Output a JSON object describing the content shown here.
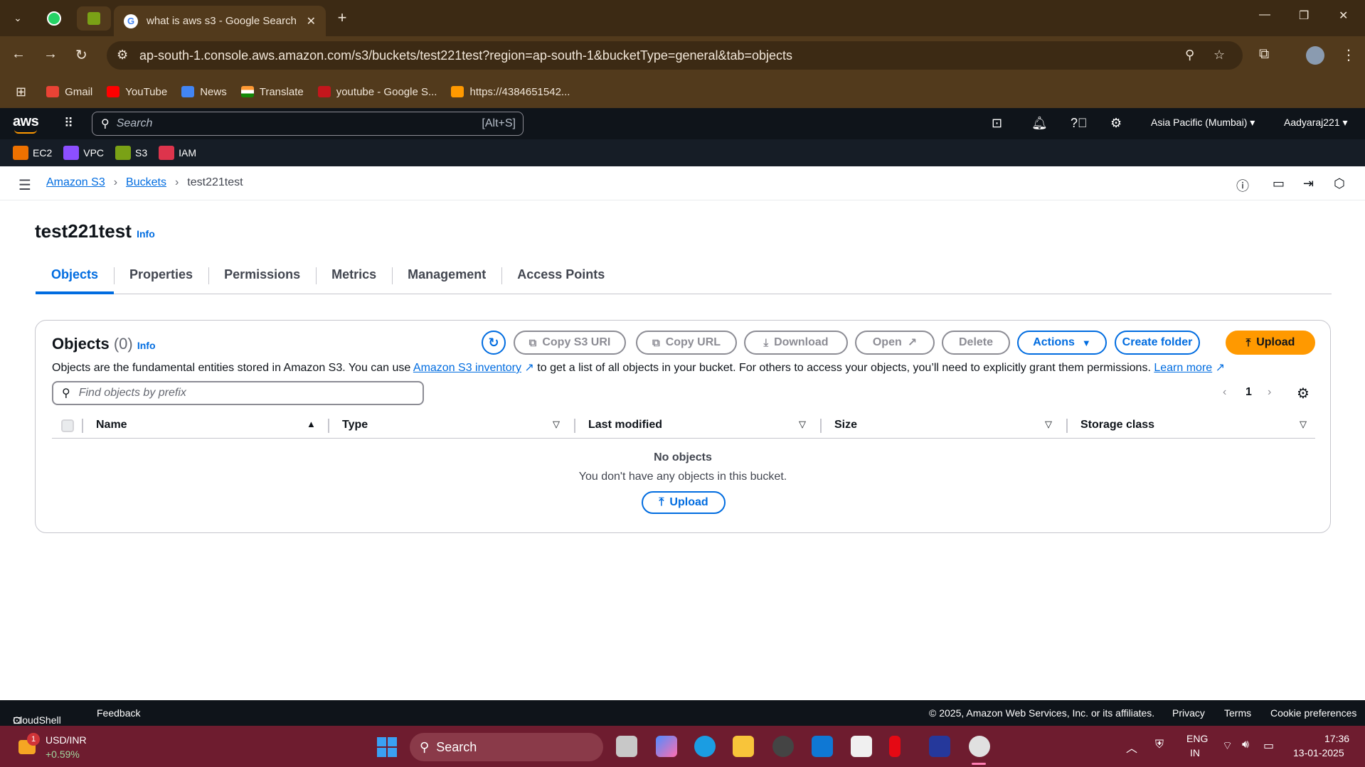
{
  "browser": {
    "active_tab_title": "what is aws s3 - Google Search",
    "url": "ap-south-1.console.aws.amazon.com/s3/buckets/test221test?region=ap-south-1&bucketType=general&tab=objects",
    "bookmarks": [
      {
        "label": "Gmail",
        "icon": "gmail-icon",
        "color": "#ea4335"
      },
      {
        "label": "YouTube",
        "icon": "youtube-icon",
        "color": "#ff0000"
      },
      {
        "label": "News",
        "icon": "news-icon",
        "color": "#4285f4"
      },
      {
        "label": "Translate",
        "icon": "india-flag-icon",
        "color": "#ff9933"
      },
      {
        "label": "youtube - Google S...",
        "icon": "su-icon",
        "color": "#c4161c"
      },
      {
        "label": "https://4384651542...",
        "icon": "aws-cube-icon",
        "color": "#ff9900"
      }
    ]
  },
  "aws_nav": {
    "logo": "aws",
    "search_placeholder": "Search",
    "search_hint": "[Alt+S]",
    "region": "Asia Pacific (Mumbai)",
    "user": "Aadyaraj221",
    "favorites": [
      {
        "label": "EC2",
        "color": "#ed7100"
      },
      {
        "label": "VPC",
        "color": "#8c4fff"
      },
      {
        "label": "S3",
        "color": "#7aa116"
      },
      {
        "label": "IAM",
        "color": "#dd344c"
      }
    ]
  },
  "breadcrumb": {
    "items": [
      "Amazon S3",
      "Buckets"
    ],
    "current": "test221test"
  },
  "header": {
    "title": "test221test",
    "info": "Info"
  },
  "tabs": [
    "Objects",
    "Properties",
    "Permissions",
    "Metrics",
    "Management",
    "Access Points"
  ],
  "objects_panel": {
    "title": "Objects",
    "count": "(0)",
    "info": "Info",
    "desc_before": "Objects are the fundamental entities stored in Amazon S3. You can use ",
    "desc_link": "Amazon S3 inventory",
    "desc_after": " to get a list of all objects in your bucket. For others to access your objects, you’ll need to explicitly grant them permissions. ",
    "learn_more": "Learn more",
    "buttons": {
      "copy_s3_uri": "Copy S3 URI",
      "copy_url": "Copy URL",
      "download": "Download",
      "open": "Open",
      "delete": "Delete",
      "actions": "Actions",
      "create_folder": "Create folder",
      "upload": "Upload"
    },
    "filter_placeholder": "Find objects by prefix",
    "page": "1",
    "columns": [
      "Name",
      "Type",
      "Last modified",
      "Size",
      "Storage class"
    ],
    "empty_title": "No objects",
    "empty_desc": "You don't have any objects in this bucket.",
    "empty_upload": "Upload"
  },
  "footer": {
    "cloudshell": "CloudShell",
    "feedback": "Feedback",
    "copyright": "© 2025, Amazon Web Services, Inc. or its affiliates.",
    "privacy": "Privacy",
    "terms": "Terms",
    "cookie": "Cookie preferences"
  },
  "taskbar": {
    "ticker": "USD/INR",
    "ticker_change": "+0.59%",
    "ticker_badge": "1",
    "search": "Search",
    "lang_1": "ENG",
    "lang_2": "IN",
    "time": "17:36",
    "date": "13-01-2025"
  },
  "colors": {
    "aws_orange": "#ff9900",
    "aws_link": "#006ce0",
    "aws_nav_bg": "#0f141a",
    "browser_bg": "#523a1c",
    "taskbar_bg": "#6e1c2f"
  }
}
